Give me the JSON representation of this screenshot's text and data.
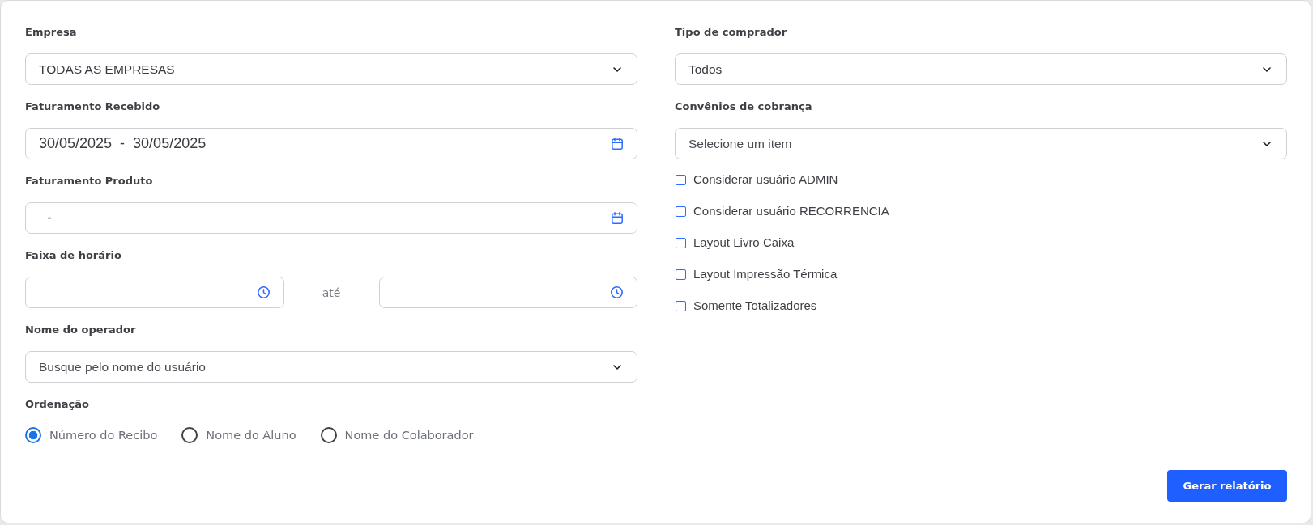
{
  "left_panel": {
    "fields": [
      {
        "kind": "select",
        "label": "Empresa",
        "value": "TODAS AS EMPRESAS"
      },
      {
        "kind": "date_range",
        "label": "Faturamento Recebido",
        "start": "30/05/2025",
        "separator": "-",
        "end": "30/05/2025"
      },
      {
        "kind": "date_range",
        "label": "Faturamento Produto",
        "separator": "-"
      },
      {
        "kind": "time_range",
        "label": "Faixa de horário",
        "joiner": "até"
      },
      {
        "kind": "select",
        "label": "Nome do operador",
        "placeholder": "Busque pelo nome do usuário"
      },
      {
        "kind": "radio_group",
        "label": "Ordenação",
        "options": [
          {
            "label": "Número do Recibo",
            "selected": true
          },
          {
            "label": "Nome do Aluno",
            "selected": false
          },
          {
            "label": "Nome do Colaborador",
            "selected": false
          }
        ]
      }
    ]
  },
  "right_panel": {
    "fields": [
      {
        "kind": "select",
        "label": "Tipo de comprador",
        "value": "Todos"
      },
      {
        "kind": "select",
        "label": "Convênios de cobrança",
        "placeholder": "Selecione um item"
      }
    ],
    "checkboxes": [
      {
        "label": "Considerar usuário ADMIN",
        "checked": false
      },
      {
        "label": "Considerar usuário RECORRENCIA",
        "checked": false
      },
      {
        "label": "Layout Livro Caixa",
        "checked": false
      },
      {
        "label": "Layout Impressão Térmica",
        "checked": false
      },
      {
        "label": "Somente Totalizadores",
        "checked": false
      }
    ]
  },
  "submit_button": {
    "label": "Gerar relatório"
  }
}
